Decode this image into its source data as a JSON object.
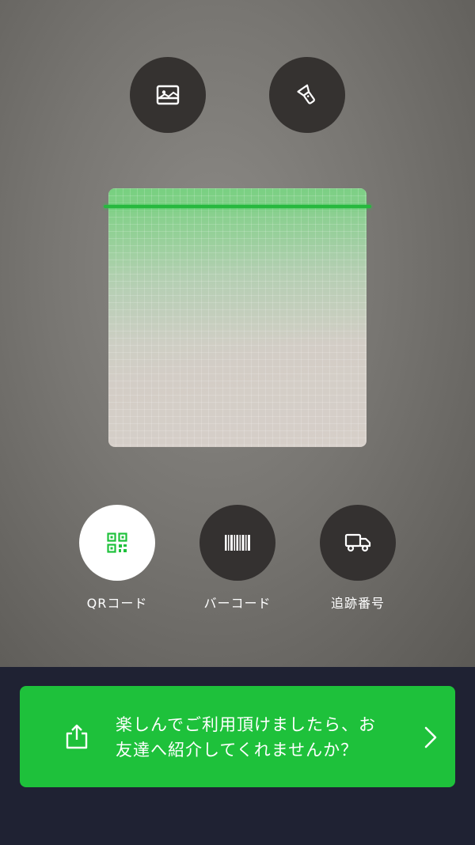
{
  "top_controls": {
    "gallery_icon": "image-icon",
    "flashlight_icon": "flashlight-icon"
  },
  "scanner": {
    "scan_line_color": "#27b83e"
  },
  "modes": [
    {
      "label": "QRコード",
      "icon": "qr-code-icon",
      "selected": true
    },
    {
      "label": "バーコード",
      "icon": "barcode-icon",
      "selected": false
    },
    {
      "label": "追跡番号",
      "icon": "truck-icon",
      "selected": false
    }
  ],
  "banner": {
    "line1": "楽しんでご利用頂けましたら、お",
    "line2": "友達へ紹介してくれませんか？",
    "share_icon": "share-icon",
    "arrow_icon": "chevron-right-icon",
    "color": "#1ec13b"
  }
}
